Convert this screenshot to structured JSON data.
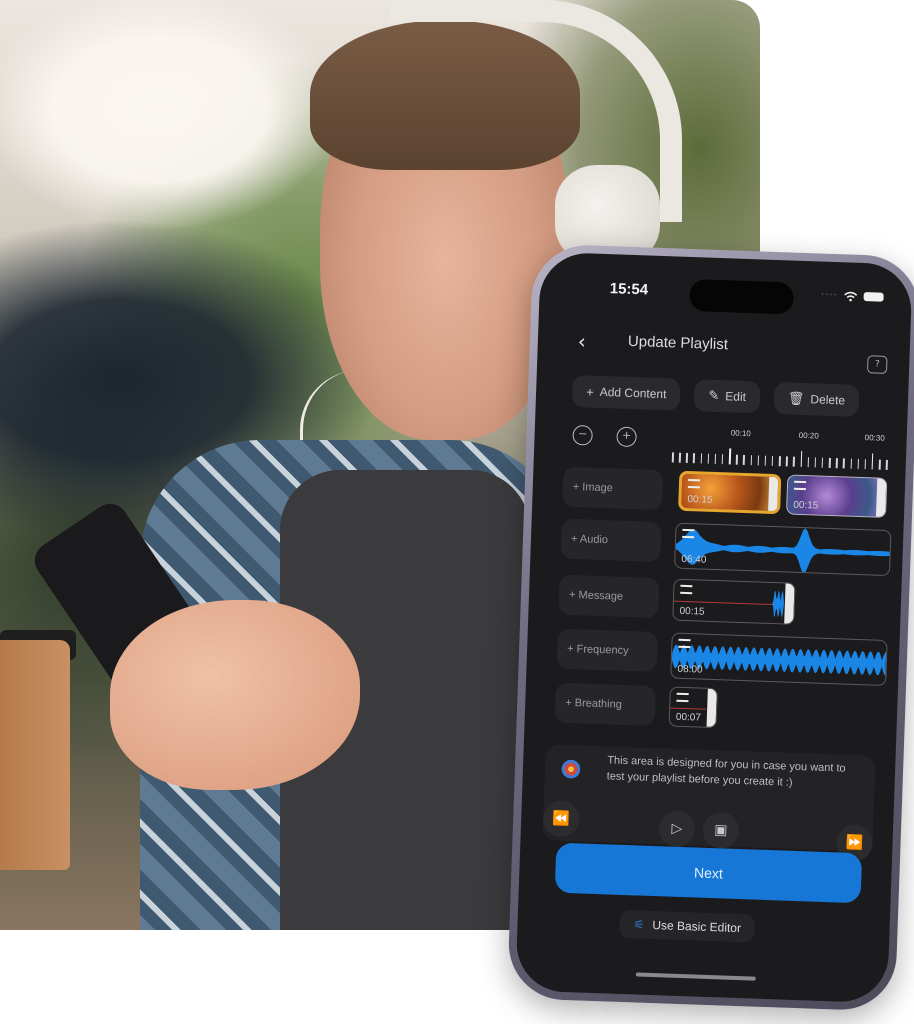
{
  "status_bar": {
    "time": "15:54",
    "signal_icon": "signal-dots-icon",
    "wifi_icon": "wifi-icon",
    "battery_icon": "battery-icon"
  },
  "nav": {
    "back_icon": "chevron-left-icon",
    "title": "Update Playlist",
    "help_icon": "help-bubble-icon",
    "help_glyph": "?"
  },
  "actions": [
    {
      "icon": "plus-icon",
      "glyph": "+",
      "label": "Add Content"
    },
    {
      "icon": "edit-icon",
      "glyph": "✎",
      "label": "Edit"
    },
    {
      "icon": "trash-icon",
      "glyph": "🗑",
      "label": "Delete"
    }
  ],
  "timeline": {
    "zoom_out_glyph": "−",
    "zoom_in_glyph": "+",
    "ruler_labels": [
      "00:10",
      "00:20",
      "00:30"
    ]
  },
  "tracks": [
    {
      "label": "+ Image",
      "clips": [
        {
          "type": "image",
          "duration": "00:15",
          "theme": "orange-abstract"
        },
        {
          "type": "image",
          "duration": "00:15",
          "theme": "purple-flowers"
        }
      ]
    },
    {
      "label": "+ Audio",
      "clips": [
        {
          "type": "audio",
          "duration": "06:40"
        }
      ]
    },
    {
      "label": "+ Message",
      "clips": [
        {
          "type": "message",
          "duration": "00:15"
        }
      ]
    },
    {
      "label": "+ Frequency",
      "clips": [
        {
          "type": "frequency",
          "duration": "08:00"
        }
      ]
    },
    {
      "label": "+ Breathing",
      "clips": [
        {
          "type": "breathing",
          "duration": "00:07"
        }
      ]
    }
  ],
  "preview": {
    "logo_icon": "mandala-logo-icon",
    "text": "This area is designed for you in case you want to test your playlist before you create it :)",
    "controls": {
      "rewind_glyph": "⏪",
      "play_glyph": "▷",
      "vr_glyph": "▣",
      "forward_glyph": "⏩"
    }
  },
  "buttons": {
    "next": "Next",
    "basic_editor": "Use Basic Editor",
    "basic_editor_icon_glyph": "⚟"
  },
  "colors": {
    "accent": "#1677d6",
    "waveform": "#1a86e6",
    "screen_bg": "#1b1b1d",
    "selected_clip_border": "#e8a52e"
  }
}
